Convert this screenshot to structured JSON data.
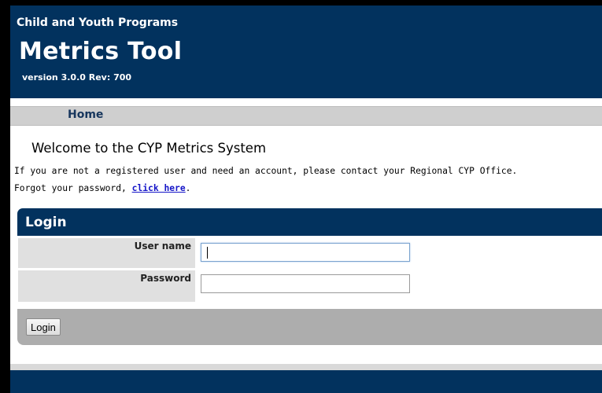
{
  "header": {
    "org": "Child and Youth Programs",
    "title": "Metrics Tool",
    "version": "version 3.0.0 Rev: 700"
  },
  "nav": {
    "home": "Home"
  },
  "content": {
    "welcome": "Welcome to the CYP Metrics System",
    "info_line": "If you are not a registered user and need an account, please contact your Regional CYP Office.",
    "forgot_prefix": "Forgot your password, ",
    "forgot_link": "click here",
    "forgot_suffix": "."
  },
  "login": {
    "title": "Login",
    "username_label": "User name",
    "username_value": "",
    "password_label": "Password",
    "password_value": "",
    "button": "Login"
  },
  "colors": {
    "header_blue": "#02325e",
    "nav_gray": "#cfcfcf",
    "link_blue": "#1515c8",
    "action_gray": "#adadad"
  }
}
